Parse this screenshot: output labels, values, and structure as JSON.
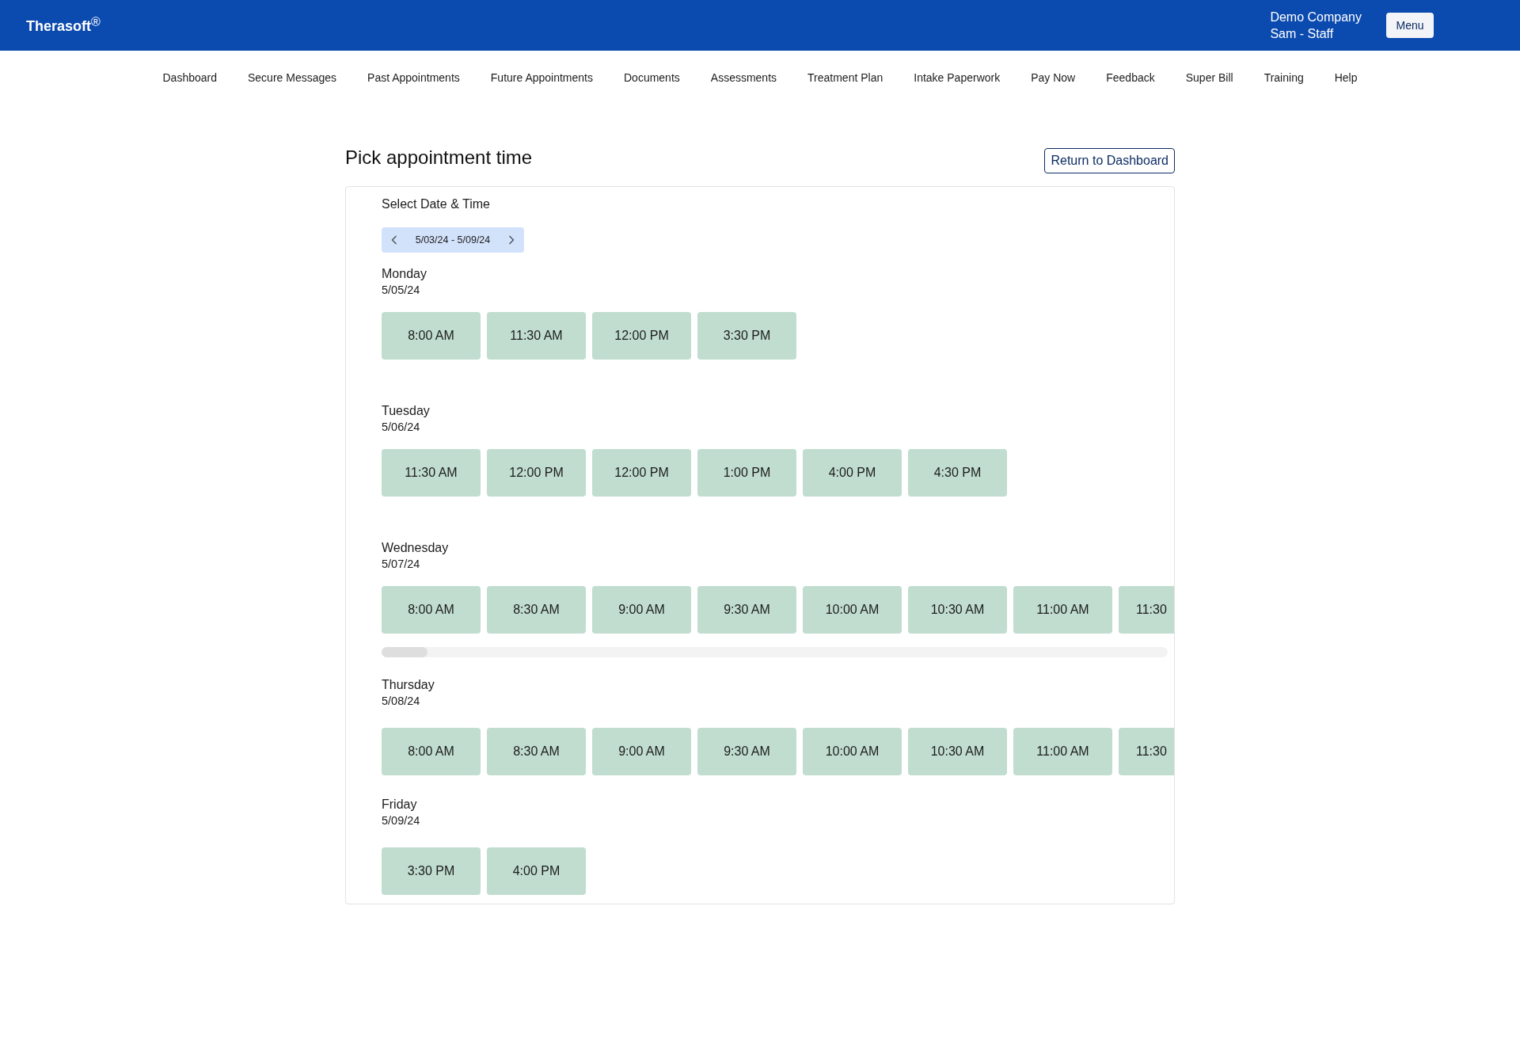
{
  "header": {
    "logo": "Therasoft$^{®}$",
    "company": "Demo Company",
    "user": "Sam - Staff",
    "menu_button": "Menu"
  },
  "nav": [
    "Dashboard",
    "Secure Messages",
    "Past Appointments",
    "Future Appointments",
    "Documents",
    "Assessments",
    "Treatment Plan",
    "Intake Paperwork",
    "Pay Now",
    "Feedback",
    "Super Bill",
    "Training",
    "Help"
  ],
  "page": {
    "title": "Pick appointment time",
    "return_button": "Return to Dashboard"
  },
  "scheduler": {
    "heading": "Select Date & Time",
    "date_range": "5/03/24 - 5/09/24",
    "days": [
      {
        "name": "Monday",
        "date": "5/05/24",
        "scrollbar": false,
        "slots": [
          {
            "time": "8:00 AM",
            "clipped": false
          },
          {
            "time": "11:30 AM",
            "clipped": false
          },
          {
            "time": "12:00 PM",
            "clipped": false
          },
          {
            "time": "3:30 PM",
            "clipped": false
          }
        ]
      },
      {
        "name": "Tuesday",
        "date": "5/06/24",
        "scrollbar": false,
        "slots": [
          {
            "time": "11:30 AM",
            "clipped": false
          },
          {
            "time": "12:00 PM",
            "clipped": false
          },
          {
            "time": "12:00 PM",
            "clipped": false
          },
          {
            "time": "1:00 PM",
            "clipped": false
          },
          {
            "time": "4:00 PM",
            "clipped": false
          },
          {
            "time": "4:30 PM",
            "clipped": false
          }
        ]
      },
      {
        "name": "Wednesday",
        "date": "5/07/24",
        "scrollbar": true,
        "slots": [
          {
            "time": "8:00 AM",
            "clipped": false
          },
          {
            "time": "8:30 AM",
            "clipped": false
          },
          {
            "time": "9:00 AM",
            "clipped": false
          },
          {
            "time": "9:30 AM",
            "clipped": false
          },
          {
            "time": "10:00 AM",
            "clipped": false
          },
          {
            "time": "10:30 AM",
            "clipped": false
          },
          {
            "time": "11:00 AM",
            "clipped": false
          },
          {
            "time": "11:30",
            "clipped": true
          }
        ]
      },
      {
        "name": "Thursday",
        "date": "5/08/24",
        "scrollbar": false,
        "slots": [
          {
            "time": "8:00 AM",
            "clipped": false
          },
          {
            "time": "8:30 AM",
            "clipped": false
          },
          {
            "time": "9:00 AM",
            "clipped": false
          },
          {
            "time": "9:30 AM",
            "clipped": false
          },
          {
            "time": "10:00 AM",
            "clipped": false
          },
          {
            "time": "10:30 AM",
            "clipped": false
          },
          {
            "time": "11:00 AM",
            "clipped": false
          },
          {
            "time": "11:30",
            "clipped": true
          }
        ]
      },
      {
        "name": "Friday",
        "date": "5/09/24",
        "scrollbar": false,
        "slots": [
          {
            "time": "3:30 PM",
            "clipped": false
          },
          {
            "time": "4:00 PM",
            "clipped": false
          }
        ]
      }
    ]
  }
}
